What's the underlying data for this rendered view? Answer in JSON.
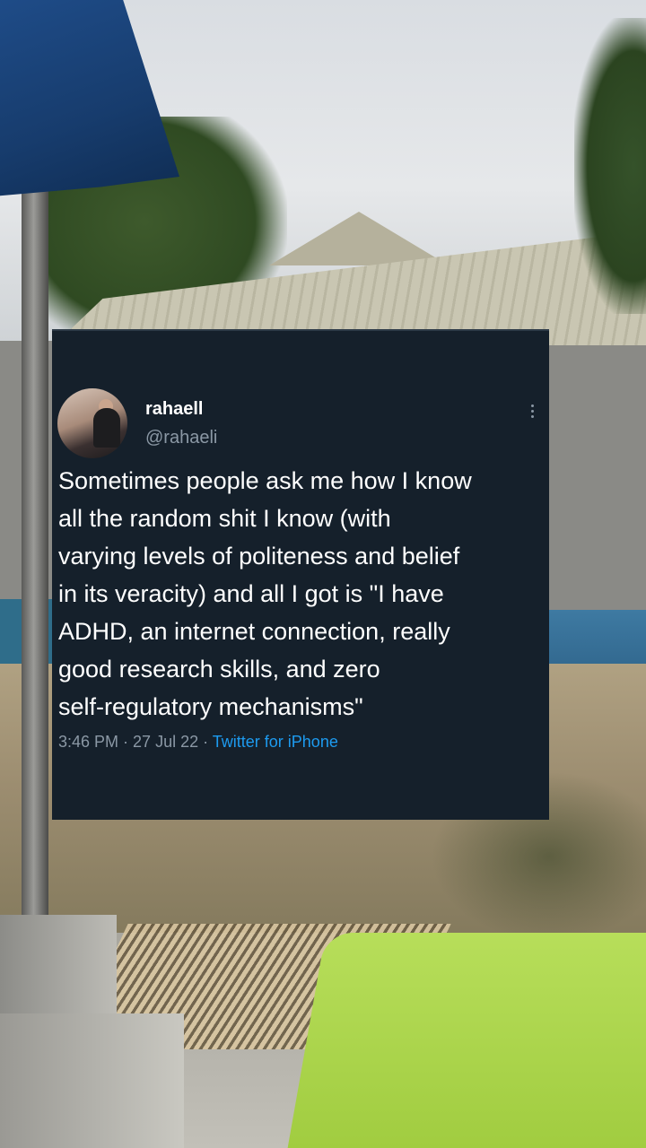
{
  "tweet": {
    "display_name": "rahaell",
    "handle": "@rahaeli",
    "text": "Sometimes people ask me how I know\nall the random shit I know (with\nvarying levels of politeness and belief\nin its veracity) and all I got is \"I have\nADHD, an internet connection, really\ngood research skills, and zero\nself-regulatory mechanisms\"",
    "time": "3:46 PM",
    "separator": " · ",
    "date": "27 Jul 22",
    "source": "Twitter for iPhone"
  },
  "icons": {
    "more": "more-vertical-icon"
  },
  "colors": {
    "card_background": "#15202b",
    "secondary_text": "#8b98a5",
    "link_blue": "#1d9bf0",
    "chair_green": "#b7de5a",
    "umbrella_blue": "#1f4d8a"
  }
}
